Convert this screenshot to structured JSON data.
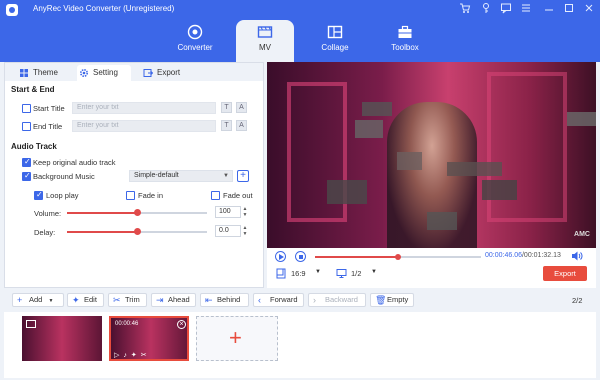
{
  "window": {
    "title": "AnyRec Video Converter (Unregistered)",
    "controls": [
      "cart-icon",
      "key-icon",
      "feedback-icon",
      "menu-icon",
      "minimize-icon",
      "maximize-icon",
      "close-icon"
    ]
  },
  "nav": {
    "tabs": [
      {
        "label": "Converter",
        "icon": "converter-icon",
        "active": false
      },
      {
        "label": "MV",
        "icon": "mv-icon",
        "active": true
      },
      {
        "label": "Collage",
        "icon": "collage-icon",
        "active": false
      },
      {
        "label": "Toolbox",
        "icon": "toolbox-icon",
        "active": false
      }
    ]
  },
  "subtabs": [
    {
      "label": "Theme",
      "icon": "grid-icon"
    },
    {
      "label": "Setting",
      "icon": "gear-icon"
    },
    {
      "label": "Export",
      "icon": "export-icon"
    }
  ],
  "start_end": {
    "title": "Start & End",
    "start_label": "Start Title",
    "end_label": "End Title",
    "placeholder": "Enter your txt",
    "t_btn": "T",
    "font_btn": "A"
  },
  "audio": {
    "title": "Audio Track",
    "keep_original": "Keep original audio track",
    "background_music": "Background Music",
    "music_value": "Simple-default",
    "loop_play": "Loop play",
    "fade_in": "Fade in",
    "fade_out": "Fade out",
    "volume_label": "Volume:",
    "volume_value": "100",
    "volume_level": 0.5,
    "delay_label": "Delay:",
    "delay_value": "0.0",
    "delay_level": 0.5
  },
  "player": {
    "time_current": "00:00:46.06",
    "time_total": "/00:01:32.13",
    "progress": 0.5,
    "ratio": "16:9",
    "page": "1/2",
    "export_label": "Export",
    "watermark": "AMC"
  },
  "toolbar": {
    "add": "Add",
    "edit": "Edit",
    "trim": "Trim",
    "ahead": "Ahead",
    "behind": "Behind",
    "forward": "Forward",
    "backward": "Backward",
    "empty": "Empty",
    "count": "2/2"
  },
  "timeline": {
    "clip2_time": "00:00:46"
  },
  "colors": {
    "brand": "#3c67e8",
    "accent": "#e84c3d"
  }
}
